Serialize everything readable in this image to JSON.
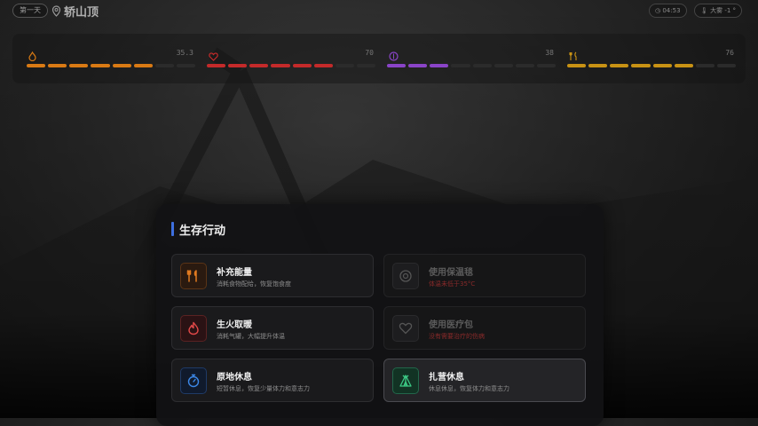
{
  "header": {
    "day_label": "第一天",
    "location_name": "轿山顶",
    "time": "04:53",
    "weather": "大雾 -1 °"
  },
  "stats": [
    {
      "icon": "flame-icon",
      "value": "35.3",
      "fraction": 0.7,
      "color": "#d97a14"
    },
    {
      "icon": "heart-icon",
      "value": "70",
      "fraction": 0.7,
      "color": "#c42a2a"
    },
    {
      "icon": "brain-icon",
      "value": "38",
      "fraction": 0.38,
      "color": "#8a44c8"
    },
    {
      "icon": "fork-knife-icon",
      "value": "76",
      "fraction": 0.76,
      "color": "#c89214"
    }
  ],
  "modal": {
    "title": "生存行动",
    "actions": [
      {
        "label": "补充能量",
        "desc": "消耗食物配给，恢复饱食度",
        "icon": "fork-knife-icon",
        "state": "enabled",
        "color": "#e07a20"
      },
      {
        "label": "使用保温毯",
        "desc": "体温未低于35°C",
        "icon": "gauge-icon",
        "state": "disabled",
        "color": "#666666"
      },
      {
        "label": "生火取暖",
        "desc": "消耗气罐，大幅提升体温",
        "icon": "fire-icon",
        "state": "enabled",
        "color": "#e04848"
      },
      {
        "label": "使用医疗包",
        "desc": "没有需要治疗的伤病",
        "icon": "heart-icon",
        "state": "disabled",
        "color": "#666666"
      },
      {
        "label": "原地休息",
        "desc": "短暂休息，恢复少量体力和意志力",
        "icon": "timer-icon",
        "state": "enabled",
        "color": "#3c88e8"
      },
      {
        "label": "扎营休息",
        "desc": "休息休息，恢复体力和意志力",
        "icon": "tent-icon",
        "state": "enabled-selected",
        "color": "#3cc884"
      }
    ]
  }
}
